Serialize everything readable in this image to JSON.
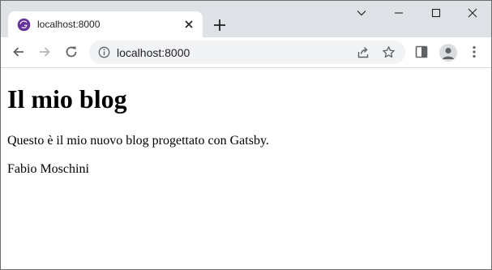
{
  "browser": {
    "tab": {
      "title": "localhost:8000",
      "favicon": "gatsby-icon"
    },
    "address": {
      "url": "localhost:8000"
    }
  },
  "page": {
    "title": "Il mio blog",
    "description": "Questo è il mio nuovo blog progettato con Gatsby.",
    "author": "Fabio Moschini"
  },
  "colors": {
    "tab_strip": "#dee1e6",
    "gatsby_purple": "#663399",
    "omnibox": "#f1f3f4"
  }
}
